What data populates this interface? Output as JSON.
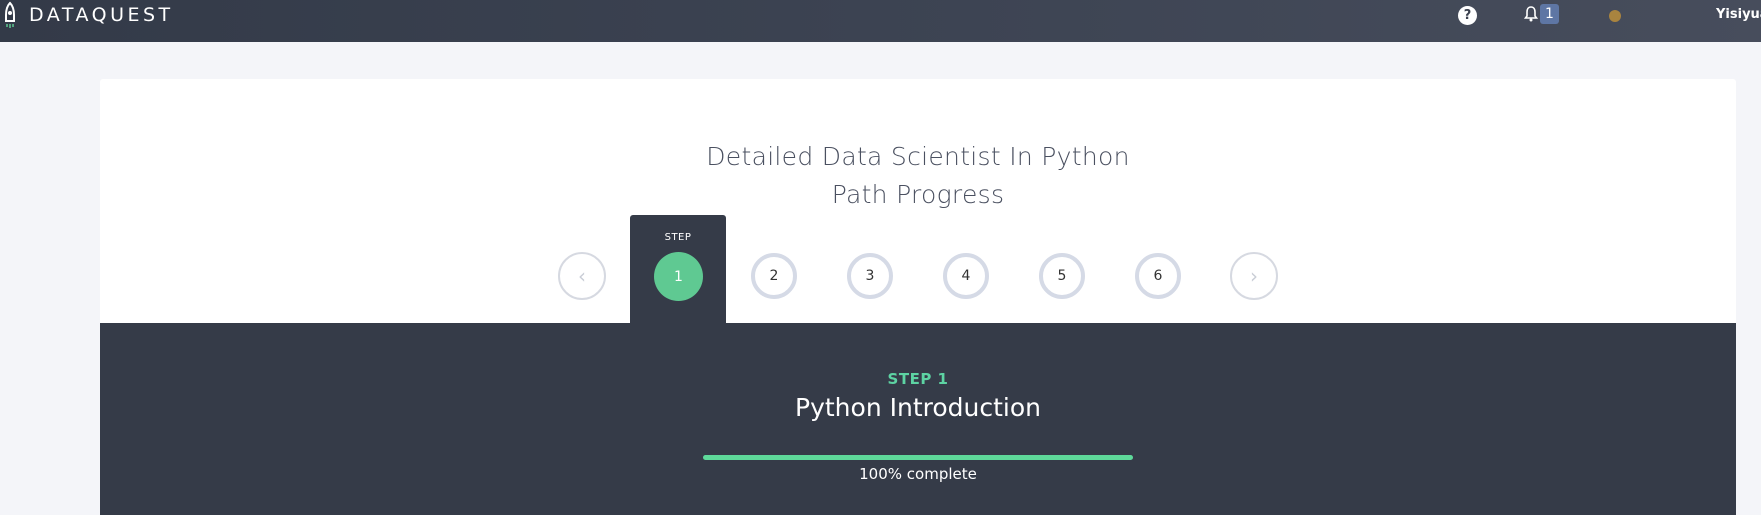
{
  "header": {
    "logo_text": "DATAQUEST",
    "help_label": "?",
    "notification_count": "1",
    "username": "Yisiyuan"
  },
  "path": {
    "title_line1": "Detailed Data Scientist In Python",
    "title_line2": "Path Progress"
  },
  "stepper": {
    "tab_label": "STEP",
    "prev_label": "‹",
    "next_label": "›",
    "steps": [
      "1",
      "2",
      "3",
      "4",
      "5",
      "6"
    ],
    "active_step": 1
  },
  "current_step": {
    "label": "STEP 1",
    "name": "Python Introduction",
    "progress_fraction": 1.0,
    "progress_text": "100% complete"
  },
  "colors": {
    "accent_green": "#5fc992",
    "dark_panel": "#353b48",
    "step_label": "#5dd3a3"
  }
}
